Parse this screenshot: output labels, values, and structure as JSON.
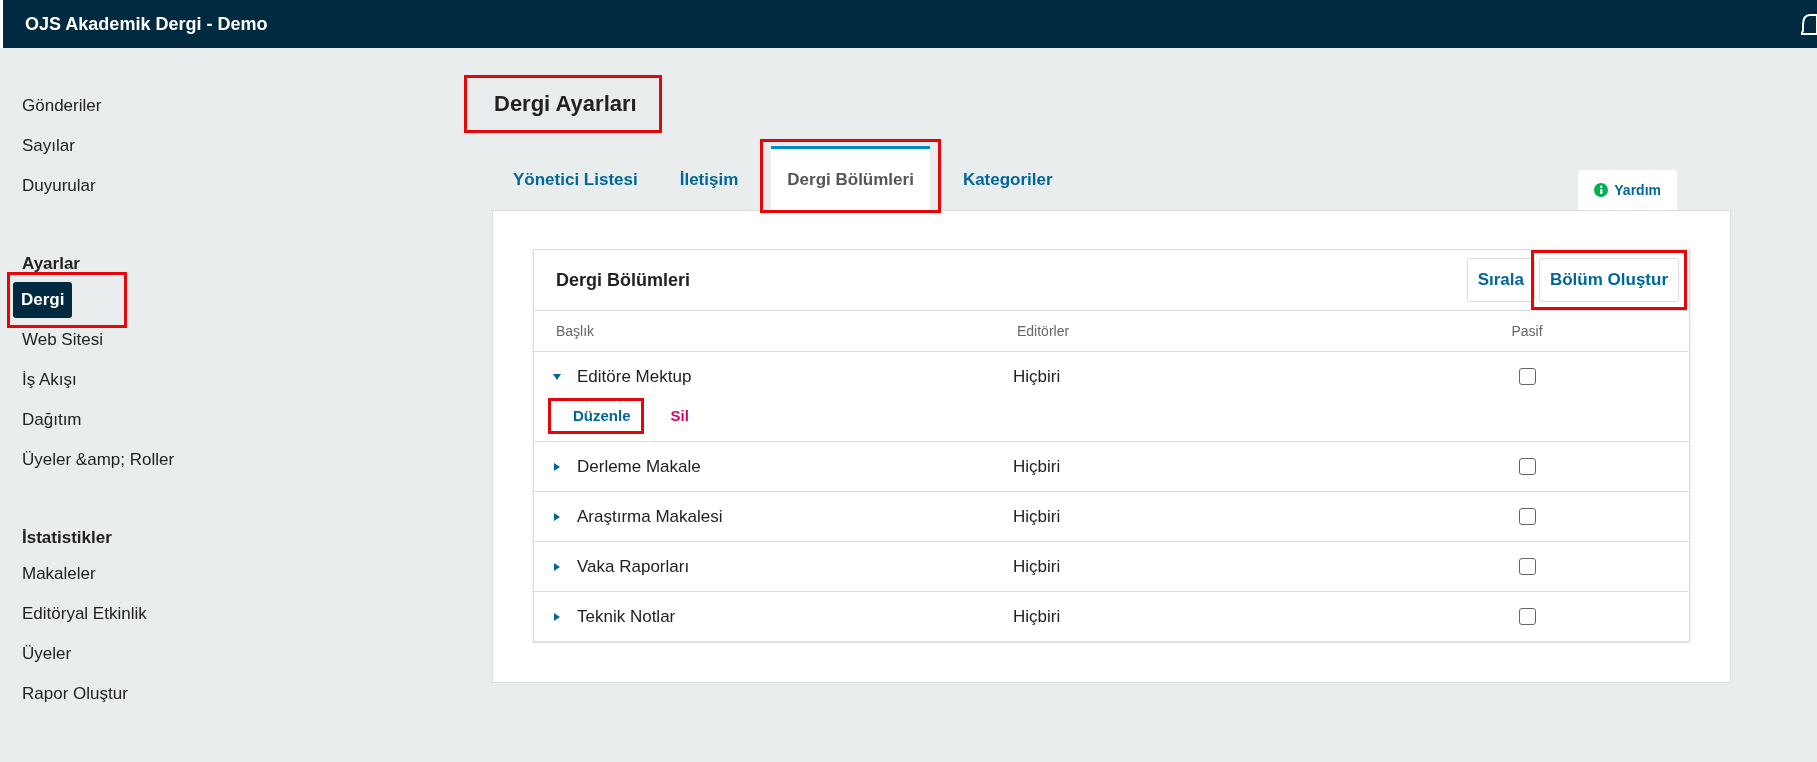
{
  "header": {
    "title": "OJS Akademik Dergi - Demo"
  },
  "sidebar": {
    "sections": [
      {
        "items": [
          {
            "label": "Gönderiler",
            "selected": false,
            "highlighted": false
          },
          {
            "label": "Sayılar",
            "selected": false,
            "highlighted": false
          },
          {
            "label": "Duyurular",
            "selected": false,
            "highlighted": false
          }
        ]
      },
      {
        "heading": "Ayarlar",
        "items": [
          {
            "label": "Dergi",
            "selected": true,
            "highlighted": true
          },
          {
            "label": "Web Sitesi",
            "selected": false,
            "highlighted": false
          },
          {
            "label": "İş Akışı",
            "selected": false,
            "highlighted": false
          },
          {
            "label": "Dağıtım",
            "selected": false,
            "highlighted": false
          },
          {
            "label": "Üyeler &amp; Roller",
            "selected": false,
            "highlighted": false
          }
        ]
      },
      {
        "heading": "İstatistikler",
        "items": [
          {
            "label": "Makaleler",
            "selected": false,
            "highlighted": false
          },
          {
            "label": "Editöryal Etkinlik",
            "selected": false,
            "highlighted": false
          },
          {
            "label": "Üyeler",
            "selected": false,
            "highlighted": false
          },
          {
            "label": "Rapor Oluştur",
            "selected": false,
            "highlighted": false
          }
        ]
      }
    ]
  },
  "page": {
    "title": "Dergi Ayarları",
    "title_highlighted": true
  },
  "tabs": [
    {
      "label": "Yönetici Listesi",
      "selected": false,
      "highlighted": false
    },
    {
      "label": "İletişim",
      "selected": false,
      "highlighted": false
    },
    {
      "label": "Dergi Bölümleri",
      "selected": true,
      "highlighted": true
    },
    {
      "label": "Kategoriler",
      "selected": false,
      "highlighted": false
    }
  ],
  "help": {
    "label": "Yardım"
  },
  "grid": {
    "title": "Dergi Bölümleri",
    "buttons": [
      {
        "label": "Sırala",
        "highlighted": false
      },
      {
        "label": "Bölüm Oluştur",
        "highlighted": true
      }
    ],
    "columns": [
      "Başlık",
      "Editörler",
      "Pasif"
    ],
    "rows": [
      {
        "title": "Editöre Mektup",
        "editors": "Hiçbiri",
        "checked": false,
        "expanded": true,
        "actions": [
          {
            "label": "Düzenle",
            "kind": "edit",
            "highlighted": true
          },
          {
            "label": "Sil",
            "kind": "delete",
            "highlighted": false
          }
        ]
      },
      {
        "title": "Derleme Makale",
        "editors": "Hiçbiri",
        "checked": false,
        "expanded": false
      },
      {
        "title": "Araştırma Makalesi",
        "editors": "Hiçbiri",
        "checked": false,
        "expanded": false
      },
      {
        "title": "Vaka Raporları",
        "editors": "Hiçbiri",
        "checked": false,
        "expanded": false
      },
      {
        "title": "Teknik Notlar",
        "editors": "Hiçbiri",
        "checked": false,
        "expanded": false
      }
    ]
  }
}
